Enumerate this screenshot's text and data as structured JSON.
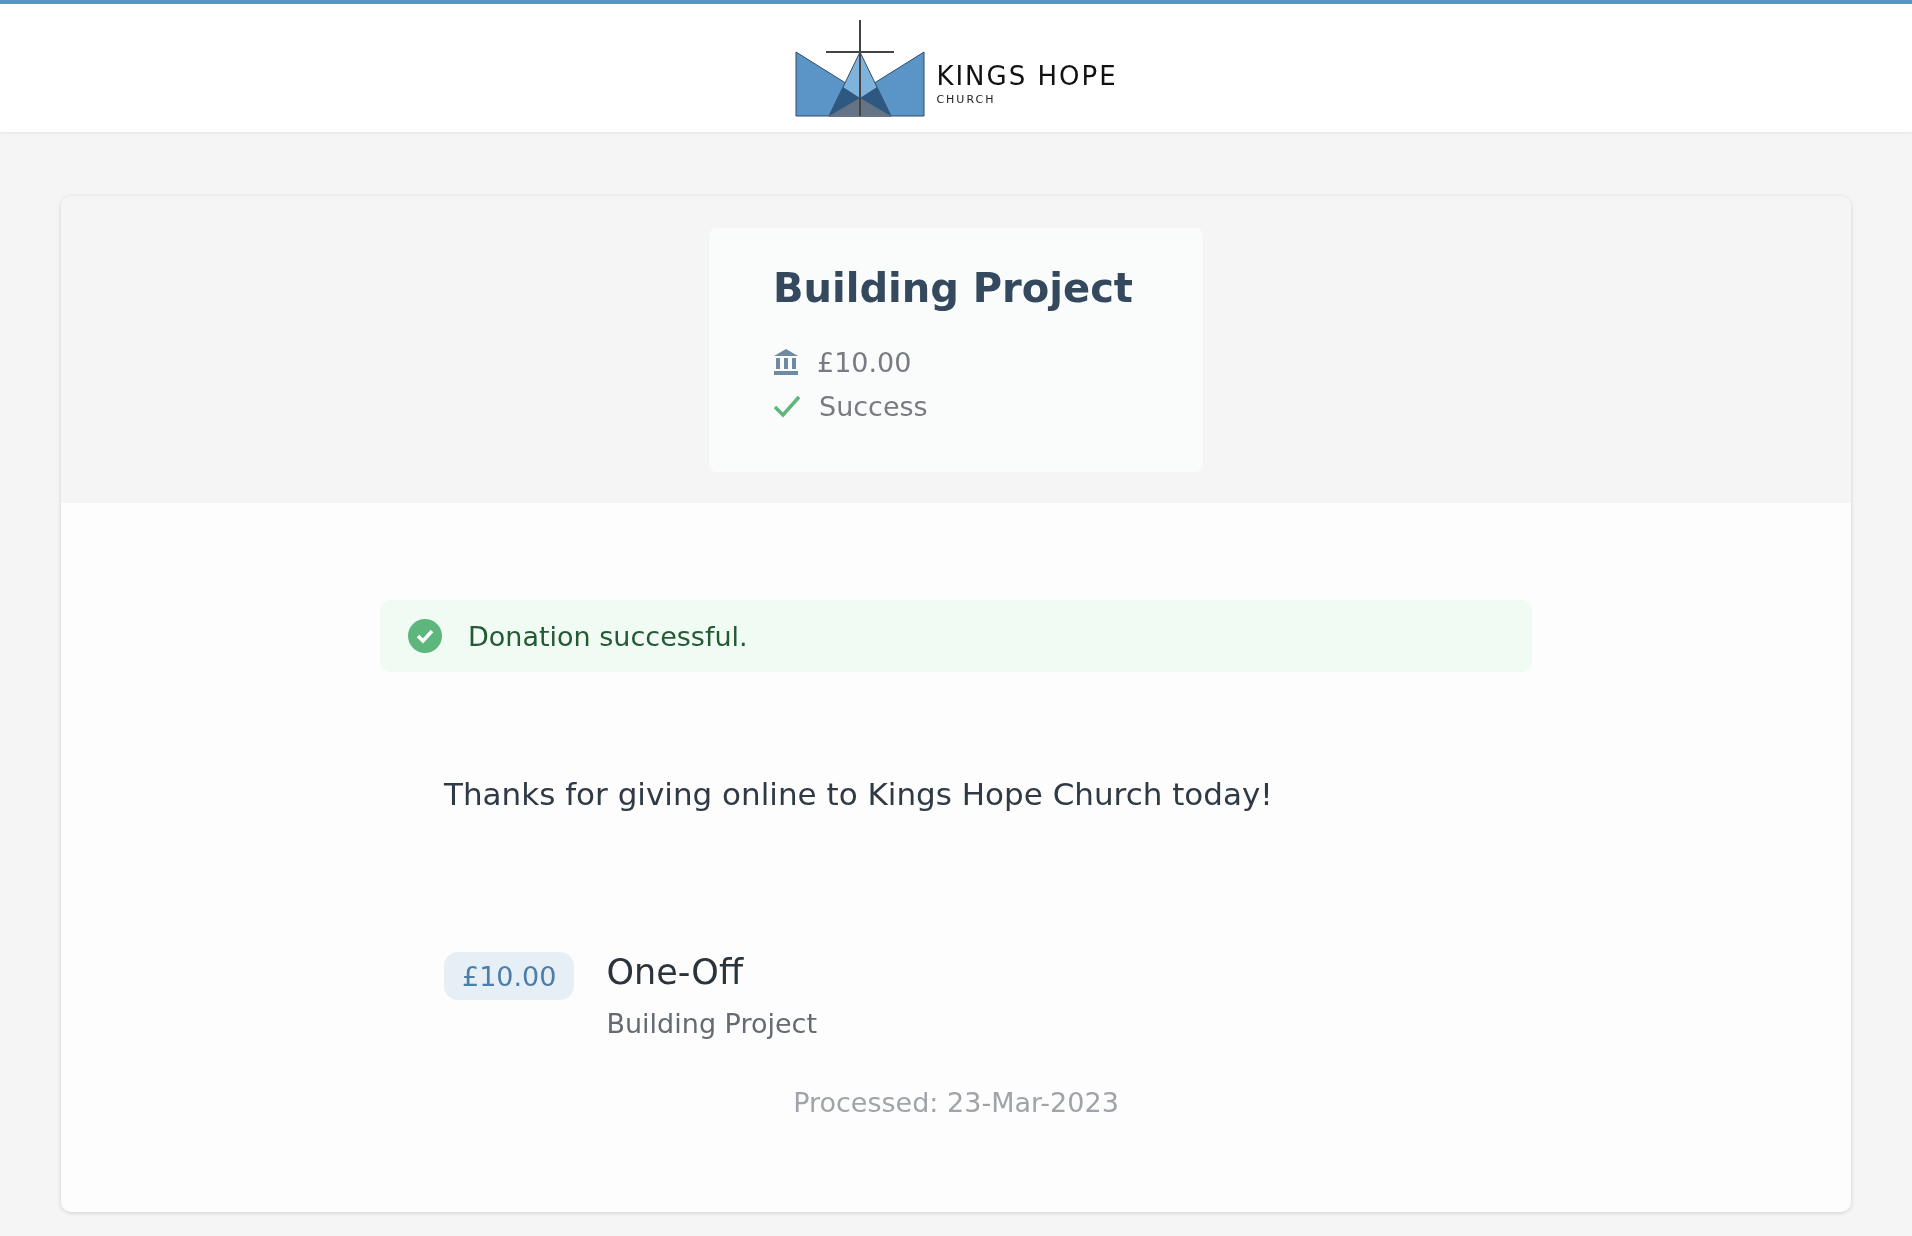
{
  "logo": {
    "name": "KINGS HOPE",
    "subtitle": "CHURCH"
  },
  "summary": {
    "title": "Building Project",
    "items": [
      {
        "kind": "amount",
        "text": "£10.00"
      },
      {
        "kind": "status",
        "text": "Success"
      }
    ]
  },
  "alert": {
    "success": true,
    "message": "Donation successful."
  },
  "thanks": "Thanks for giving online to Kings Hope Church today!",
  "donation": {
    "amount": "£10.00",
    "frequency": "One-Off",
    "fund": "Building Project",
    "processed": "Processed: 23-Mar-2023"
  }
}
